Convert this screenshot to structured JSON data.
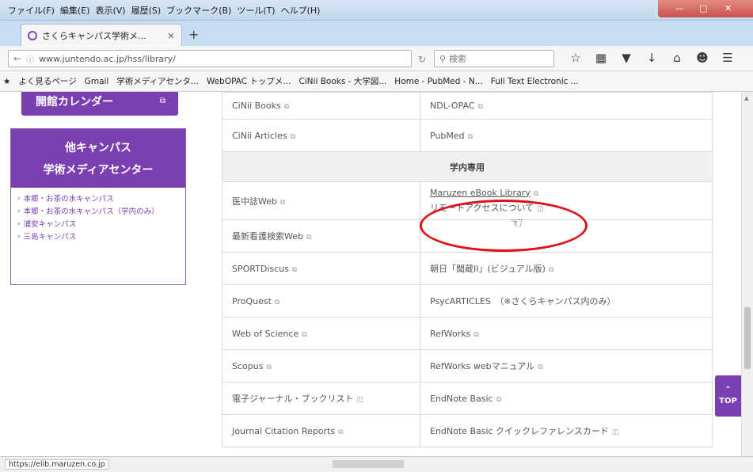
{
  "browser": {
    "menu": [
      "ファイル(F)",
      "編集(E)",
      "表示(V)",
      "履歴(S)",
      "ブックマーク(B)",
      "ツール(T)",
      "ヘルプ(H)"
    ],
    "tab_title": "さくらキャンパス学術メ...",
    "tab_close": "×",
    "new_tab": "+",
    "url": "www.juntendo.ac.jp/hss/library/",
    "search_placeholder": "検索",
    "bookmarks": [
      "よく見るページ",
      "Gmail",
      "学術メディアセンタ...",
      "WebOPAC トップメ...",
      "CiNii Books - 大学図...",
      "Home - PubMed - N...",
      "Full Text Electronic ..."
    ],
    "status_url": "https://elib.maruzen.co.jp"
  },
  "sidebar": {
    "top_button": "開館カレンダー",
    "box_title_line1": "他キャンパス",
    "box_title_line2": "学術メディアセンター",
    "links": [
      "本郷・お茶の水キャンパス",
      "本郷・お茶の水キャンパス（学内のみ）",
      "浦安キャンパス",
      "三島キャンパス"
    ]
  },
  "table": {
    "rows_top": [
      [
        "CiNii Books",
        "NDL-OPAC"
      ],
      [
        "CiNii Articles",
        "PubMed"
      ]
    ],
    "section_header": "学内専用",
    "row_highlight": {
      "left": "医中誌Web",
      "right_line1": "Maruzen eBook Library",
      "right_line2": "リモートアクセスについて"
    },
    "rows_bottom": [
      [
        "最新看護検索Web",
        ""
      ],
      [
        "SPORTDiscus",
        "朝日「聞蔵II」(ビジュアル版)"
      ],
      [
        "ProQuest",
        "PsycARTICLES　（※さくらキャンパス内のみ）"
      ],
      [
        "Web of Science",
        "RefWorks"
      ],
      [
        "Scopus",
        "RefWorks webマニュアル"
      ],
      [
        "電子ジャーナル・ブックリスト",
        "EndNote Basic"
      ],
      [
        "Journal Citation Reports",
        "EndNote Basic クイックレファレンスカード"
      ]
    ]
  },
  "top_button": "TOP",
  "colors": {
    "accent_purple": "#7a3fb0",
    "highlight_red": "#e01018"
  }
}
